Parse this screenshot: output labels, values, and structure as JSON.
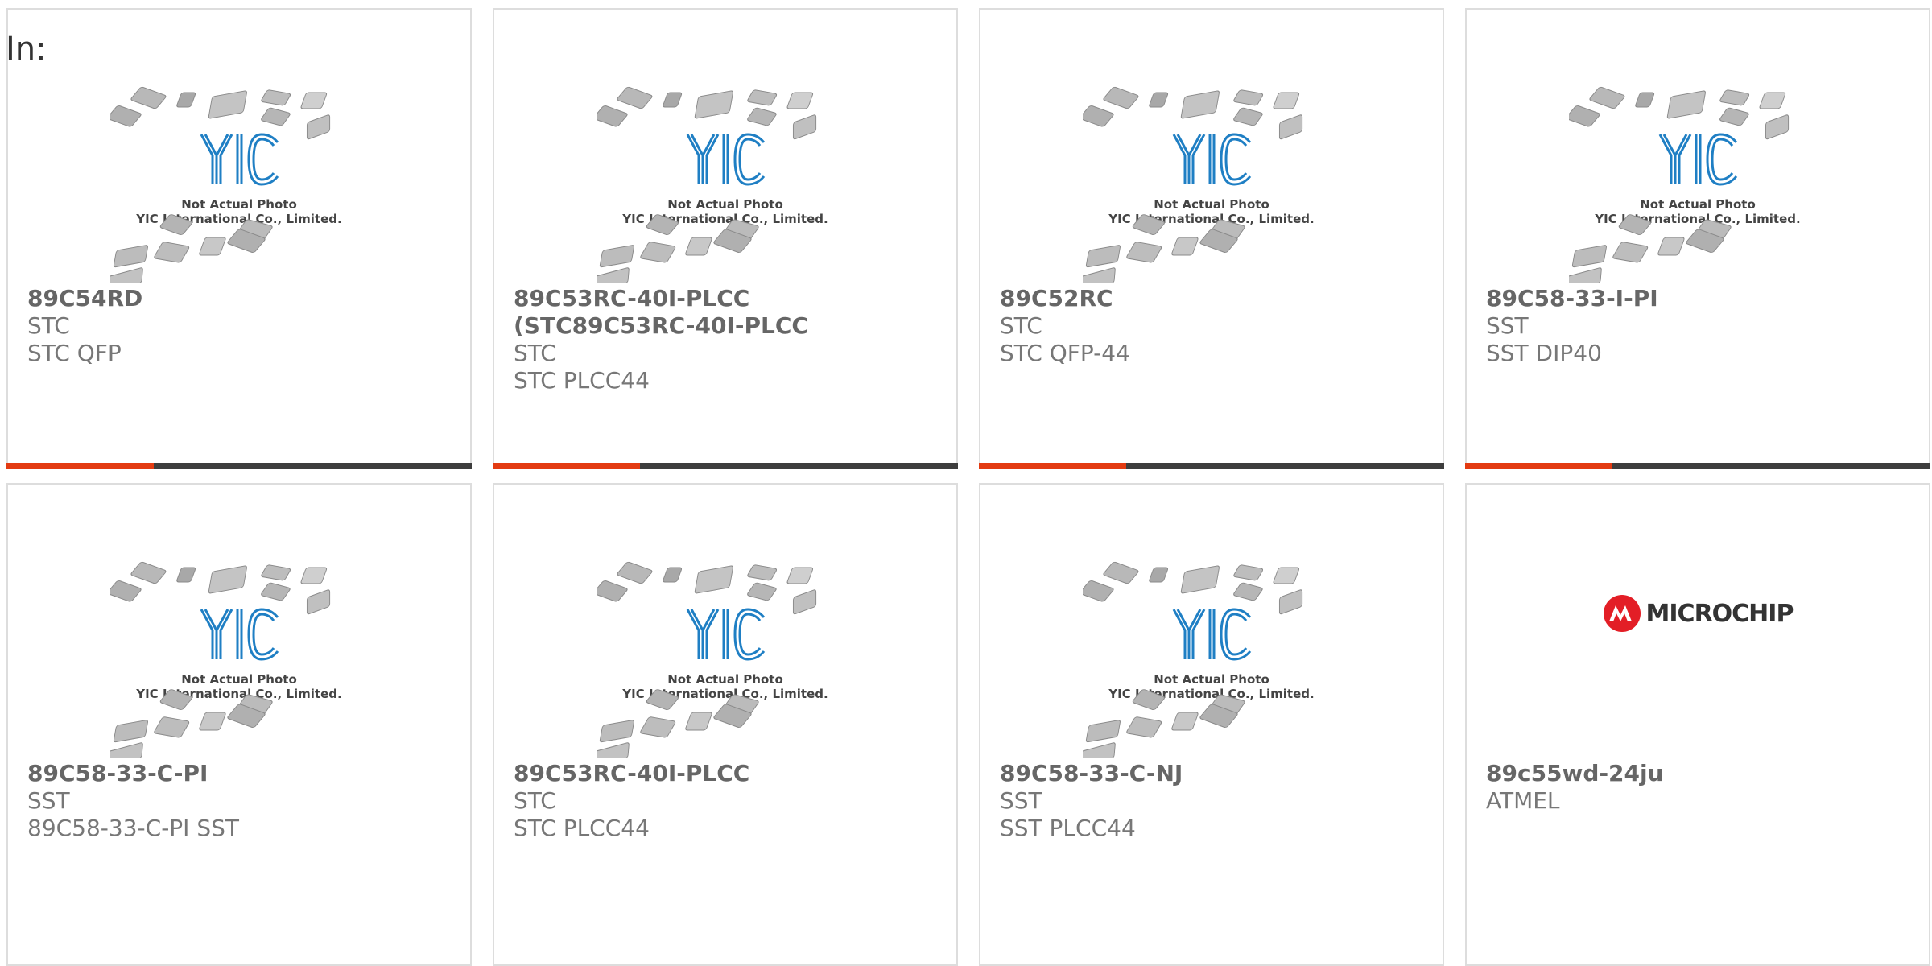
{
  "header": {
    "label": "In:"
  },
  "placeholder_image": {
    "brand": "YIC",
    "line1": "Not Actual Photo",
    "line2": "YIC International Co., Limited."
  },
  "colors": {
    "accent": "#e33b12",
    "bar": "#3d3d3d",
    "yic_blue": "#1f7fc4",
    "microchip_red": "#e31e26"
  },
  "products": [
    {
      "part": "89C54RD",
      "maker": "STC",
      "desc": "STC QFP",
      "image": "yic-placeholder"
    },
    {
      "part": "89C53RC-40I-PLCC (STC89C53RC-40I-PLCC",
      "maker": "STC",
      "desc": "STC PLCC44",
      "image": "yic-placeholder"
    },
    {
      "part": "89C52RC",
      "maker": "STC",
      "desc": "STC QFP-44",
      "image": "yic-placeholder"
    },
    {
      "part": "89C58-33-I-PI",
      "maker": "SST",
      "desc": "SST DIP40",
      "image": "yic-placeholder"
    },
    {
      "part": "89C58-33-C-PI",
      "maker": "SST",
      "desc": "89C58-33-C-PI SST",
      "image": "yic-placeholder"
    },
    {
      "part": "89C53RC-40I-PLCC",
      "maker": "STC",
      "desc": "STC PLCC44",
      "image": "yic-placeholder"
    },
    {
      "part": "89C58-33-C-NJ",
      "maker": "SST",
      "desc": "SST PLCC44",
      "image": "yic-placeholder"
    },
    {
      "part": "89c55wd-24ju",
      "maker": "ATMEL",
      "desc": "",
      "image": "microchip-logo",
      "logo_text": "MICROCHIP"
    }
  ]
}
